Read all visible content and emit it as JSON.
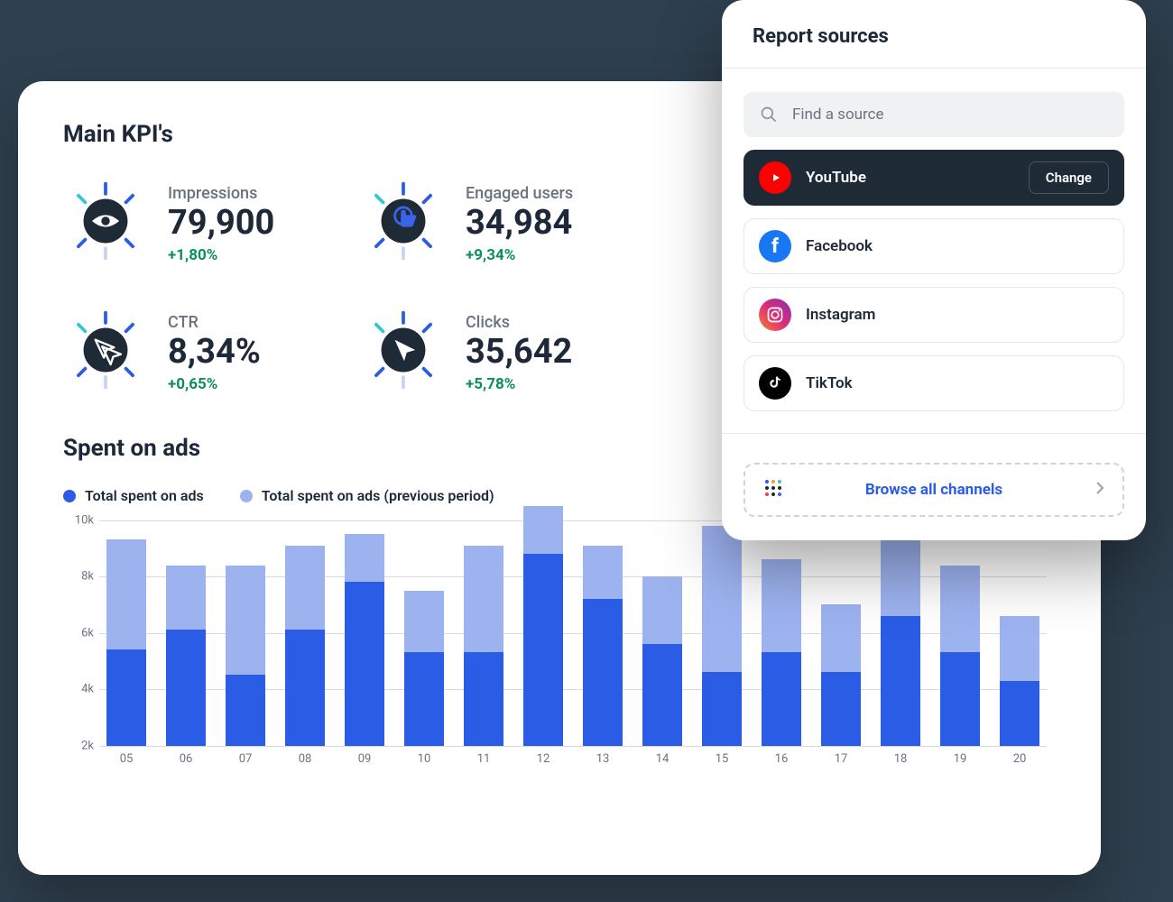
{
  "dashboard": {
    "main_kpi_header": "Main KPI's",
    "kpis": [
      {
        "label": "Impressions",
        "value": "79,900",
        "delta": "+1,80%",
        "icon": "eye-icon"
      },
      {
        "label": "Engaged users",
        "value": "34,984",
        "delta": "+9,34%",
        "icon": "tap-icon"
      },
      {
        "label": "CTR",
        "value": "8,34%",
        "delta": "+0,65%",
        "icon": "double-cursor-icon"
      },
      {
        "label": "Clicks",
        "value": "35,642",
        "delta": "+5,78%",
        "icon": "cursor-icon"
      }
    ],
    "spent_header": "Spent on ads",
    "legend": {
      "current": "Total spent on ads",
      "previous": "Total spent on ads (previous period)"
    }
  },
  "chart_data": {
    "type": "bar",
    "title": "Spent on ads",
    "xlabel": "",
    "ylabel": "",
    "ylim": [
      2000,
      10000
    ],
    "yaxis_ticks": [
      "2k",
      "4k",
      "6k",
      "8k",
      "10k"
    ],
    "categories": [
      "05",
      "06",
      "07",
      "08",
      "09",
      "10",
      "11",
      "12",
      "13",
      "14",
      "15",
      "16",
      "17",
      "18",
      "19",
      "20"
    ],
    "series": [
      {
        "name": "Total spent on ads",
        "values": [
          5400,
          6100,
          4500,
          6100,
          7800,
          5300,
          5300,
          8800,
          7200,
          5600,
          4600,
          5300,
          4600,
          6600,
          5300,
          4300
        ]
      },
      {
        "name": "Total spent on ads (previous period)",
        "values": [
          9300,
          8400,
          8400,
          9100,
          9500,
          7500,
          9100,
          10500,
          9100,
          8000,
          9800,
          8600,
          7000,
          9300,
          8400,
          6600
        ]
      }
    ]
  },
  "panel": {
    "title": "Report sources",
    "search_placeholder": "Find a source",
    "sources": [
      {
        "name": "YouTube",
        "selected": true,
        "action": "Change"
      },
      {
        "name": "Facebook",
        "selected": false
      },
      {
        "name": "Instagram",
        "selected": false
      },
      {
        "name": "TikTok",
        "selected": false
      }
    ],
    "browse_label": "Browse all channels"
  }
}
